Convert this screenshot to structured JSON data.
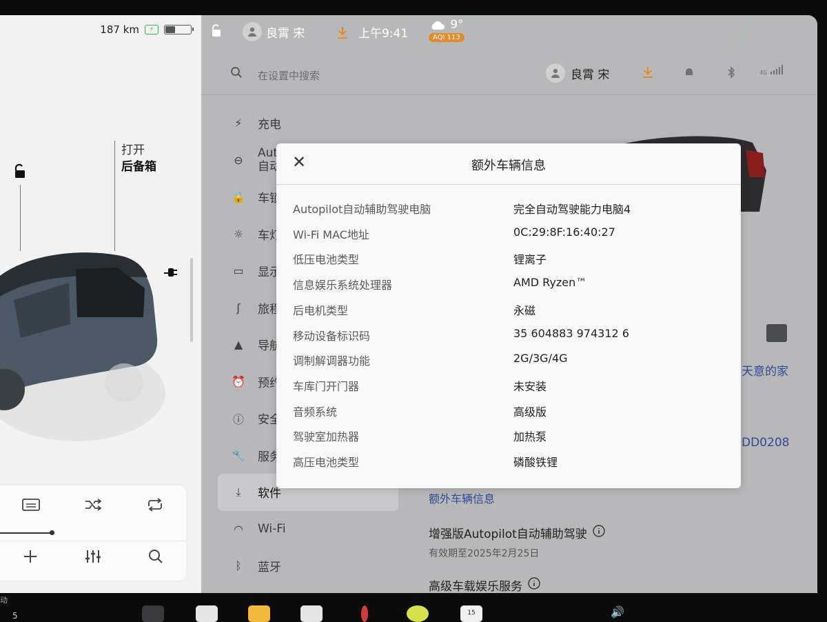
{
  "car_panel": {
    "range": "187 km",
    "trunk_label_line1": "打开",
    "trunk_label_line2": "后备箱"
  },
  "status_bar": {
    "user_name": "良霄 宋",
    "time": "上午9:41",
    "temperature": "9°",
    "aqi": "AQI 113"
  },
  "search": {
    "placeholder": "在设置中搜索"
  },
  "header_user": "良霄 宋",
  "signal_label": "4G",
  "menu": {
    "items": [
      {
        "label": "充电",
        "icon": "lightning-icon"
      },
      {
        "label": "Aut",
        "label2": "自动",
        "icon": "steering-wheel-icon"
      },
      {
        "label": "车锁",
        "icon": "lock-icon"
      },
      {
        "label": "车灯",
        "icon": "light-icon"
      },
      {
        "label": "显示",
        "icon": "display-icon"
      },
      {
        "label": "旅程",
        "icon": "trip-icon"
      },
      {
        "label": "导航",
        "icon": "navigation-icon"
      },
      {
        "label": "预约",
        "icon": "schedule-icon"
      },
      {
        "label": "安全",
        "icon": "safety-icon"
      },
      {
        "label": "服务",
        "icon": "wrench-icon"
      },
      {
        "label": "软件",
        "icon": "download-icon"
      },
      {
        "label": "Wi-Fi",
        "icon": "wifi-icon"
      },
      {
        "label": "蓝牙",
        "icon": "bluetooth-icon"
      }
    ]
  },
  "right_content": {
    "home_text": "天意的家",
    "code_text": "DD0208",
    "extra_info_link": "额外车辆信息",
    "autopilot_title": "增强版Autopilot自动辅助驾驶",
    "autopilot_expiry": "有效期至2025年2月25日",
    "premium_title": "高级车载娱乐服务"
  },
  "modal": {
    "title": "额外车辆信息",
    "rows": [
      {
        "label": "Autopilot自动辅助驾驶电脑",
        "value": "完全自动驾驶能力电脑4"
      },
      {
        "label": "Wi-Fi MAC地址",
        "value": "0C:29:8F:16:40:27"
      },
      {
        "label": "低压电池类型",
        "value": "锂离子"
      },
      {
        "label": "信息娱乐系统处理器",
        "value": "AMD Ryzen™"
      },
      {
        "label": "后电机类型",
        "value": "永磁"
      },
      {
        "label": "移动设备标识码",
        "value": "35 604883 974312 6"
      },
      {
        "label": "调制解调器功能",
        "value": "2G/3G/4G"
      },
      {
        "label": "车库门开门器",
        "value": "未安装"
      },
      {
        "label": "音频系统",
        "value": "高级版"
      },
      {
        "label": "驾驶室加热器",
        "value": "加热泵"
      },
      {
        "label": "高压电池类型",
        "value": "磷酸铁锂"
      }
    ]
  },
  "dock": {
    "left_partial": "动",
    "number": "5",
    "calendar_day": "15"
  },
  "colors": {
    "accent_orange": "#e58a2a",
    "link_blue": "#2c4a96",
    "charge_green": "#3bb34a"
  }
}
